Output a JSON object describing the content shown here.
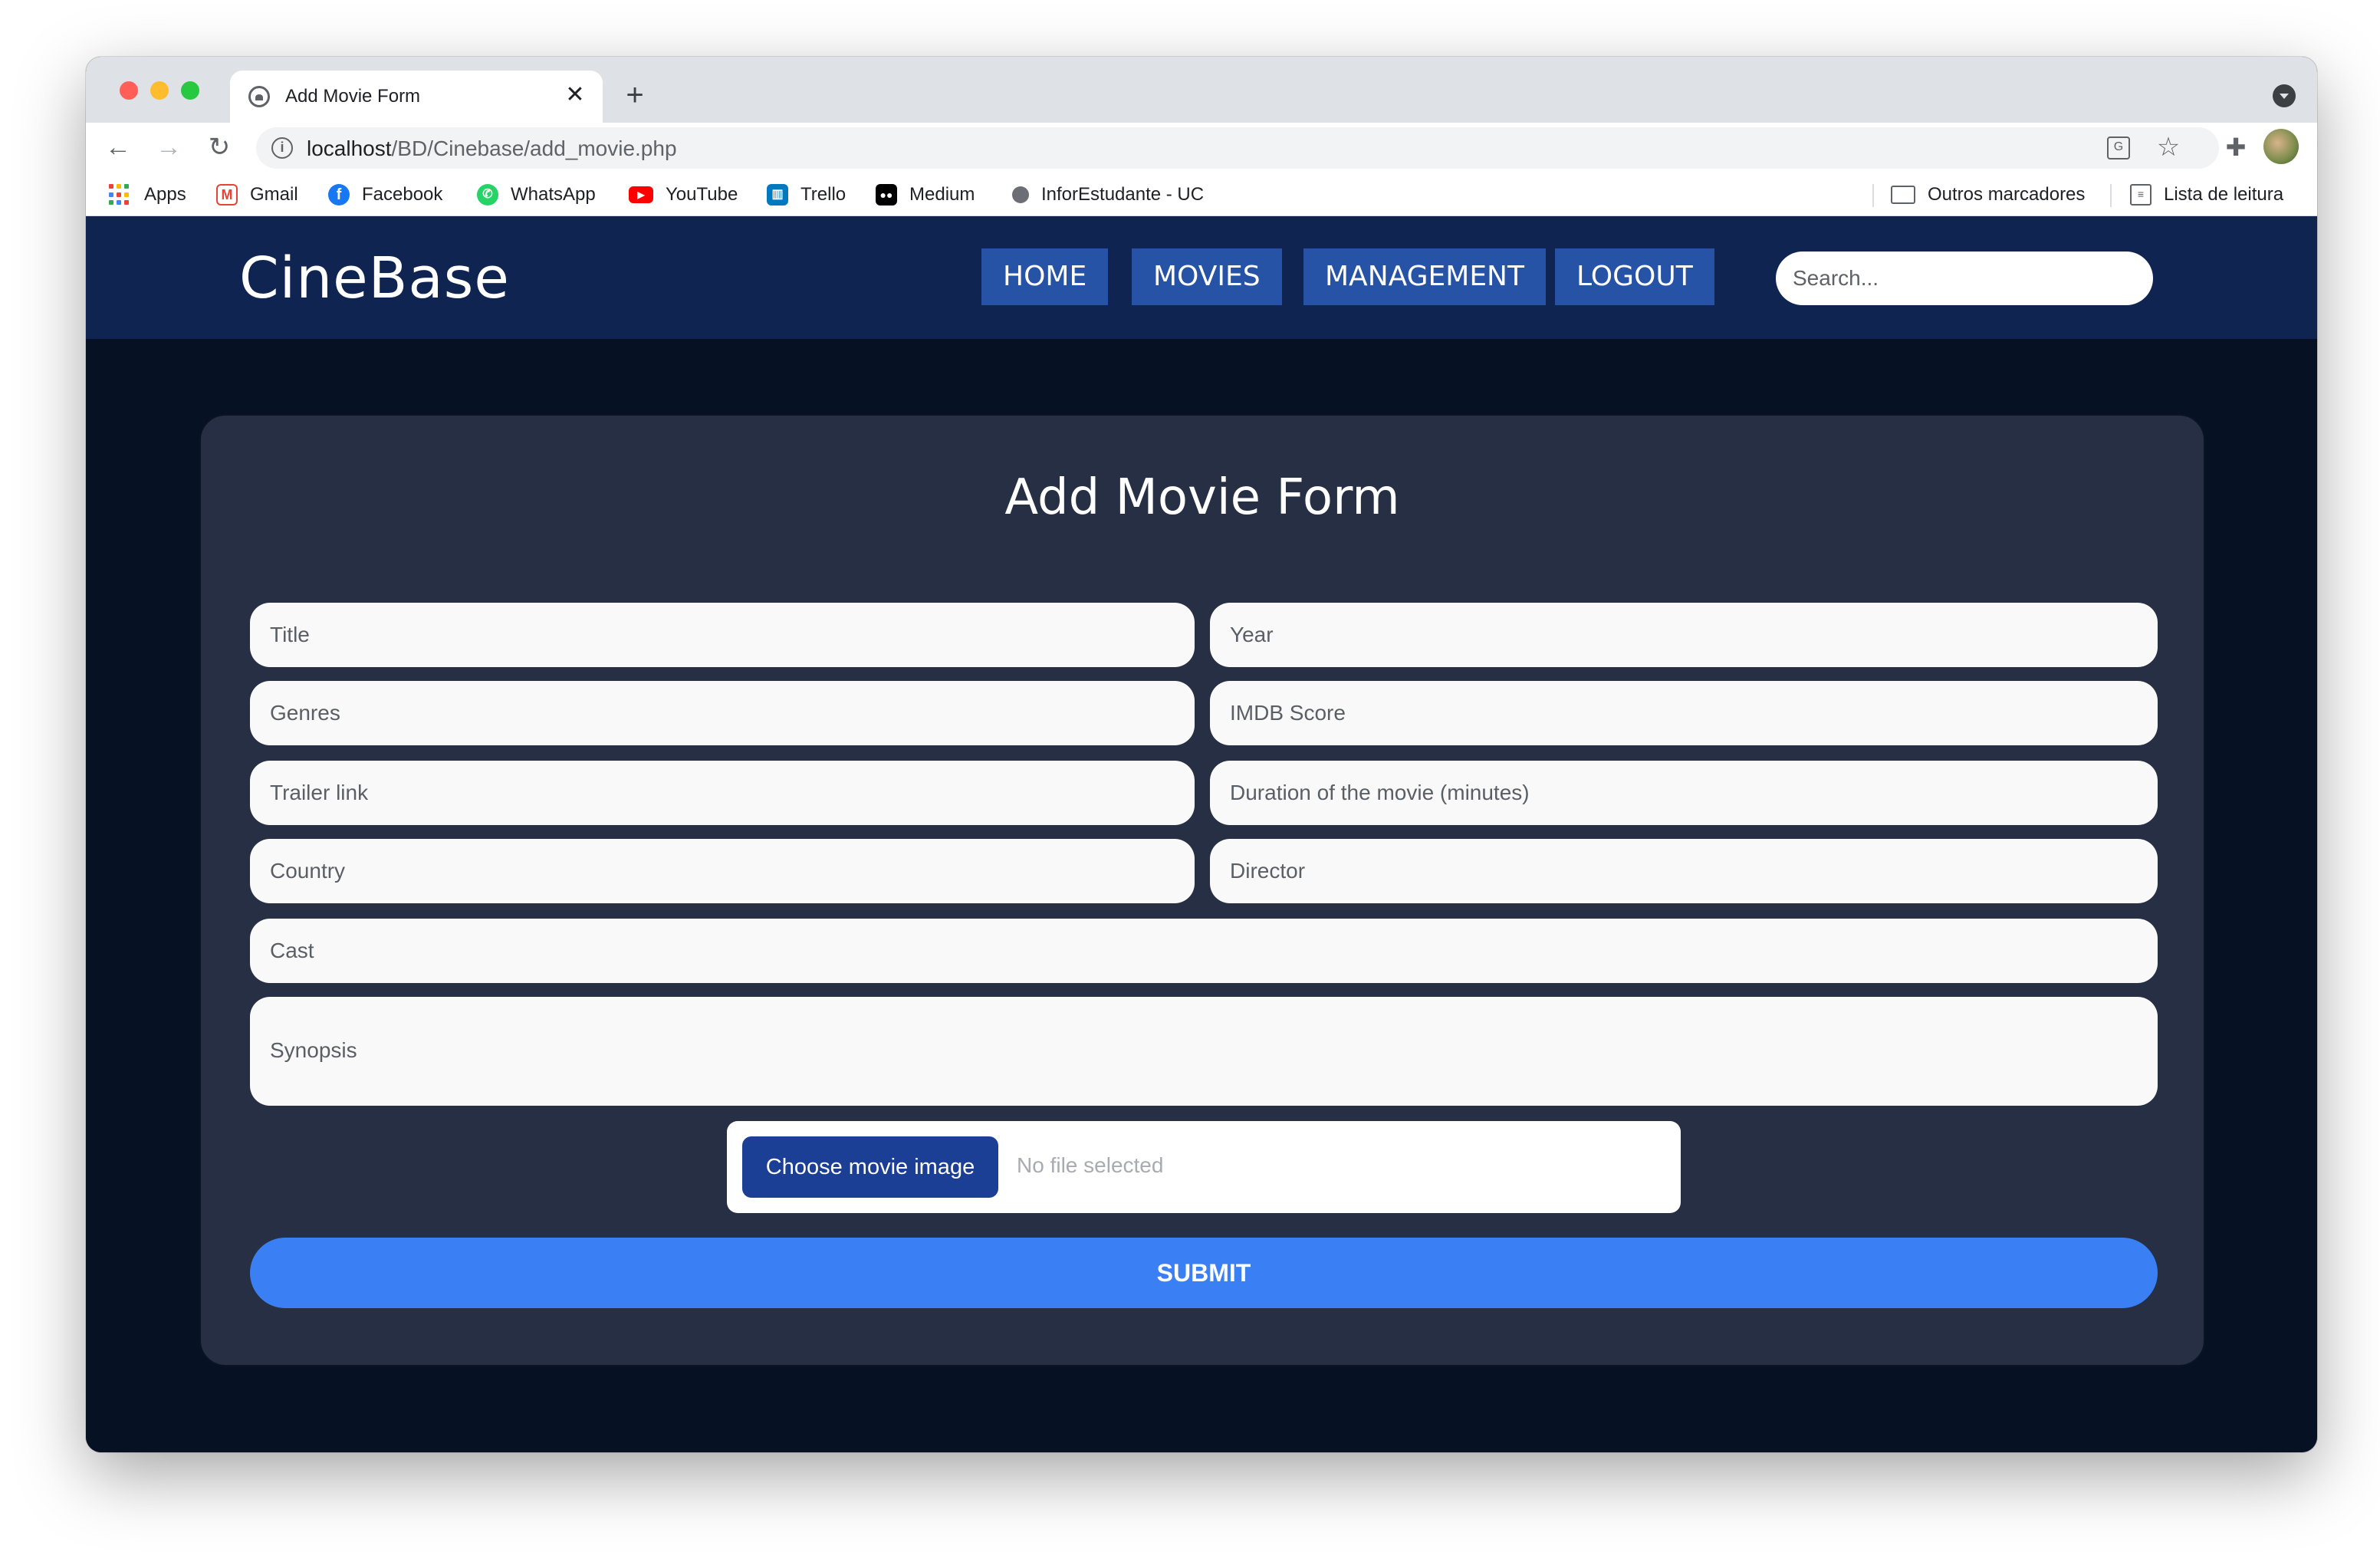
{
  "browser": {
    "tab_title": "Add Movie Form",
    "tab_close": "✕",
    "new_tab": "+",
    "url_host": "localhost",
    "url_path": "/BD/Cinebase/add_movie.php",
    "bookmarks": {
      "apps": "Apps",
      "gmail": "Gmail",
      "facebook": "Facebook",
      "whatsapp": "WhatsApp",
      "youtube": "YouTube",
      "trello": "Trello",
      "medium": "Medium",
      "inforestudante": "InforEstudante - UC",
      "other": "Outros marcadores",
      "reading_list": "Lista de leitura"
    },
    "colors": {
      "gmail": "#ea4335",
      "facebook": "#1877f2",
      "whatsapp": "#25d366",
      "youtube": "#ff0000",
      "trello": "#0079bf",
      "medium": "#000000"
    }
  },
  "site": {
    "brand": "CineBase",
    "nav": {
      "home": "HOME",
      "movies": "MOVIES",
      "management": "MANAGEMENT",
      "logout": "LOGOUT"
    },
    "search_placeholder": "Search...",
    "colors": {
      "header_bg": "#102452",
      "nav_button": "#2653a5",
      "page_bg": "#061123",
      "card_bg": "#262f43",
      "submit": "#3a80f4",
      "file_button": "#1a3f95"
    }
  },
  "form": {
    "title": "Add Movie Form",
    "placeholders": {
      "title": "Title",
      "year": "Year",
      "genres": "Genres",
      "imdb": "IMDB Score",
      "trailer": "Trailer link",
      "duration": "Duration of the movie (minutes)",
      "country": "Country",
      "director": "Director",
      "cast": "Cast",
      "synopsis": "Synopsis"
    },
    "file_button": "Choose movie image",
    "file_status": "No file selected",
    "submit": "SUBMIT"
  }
}
